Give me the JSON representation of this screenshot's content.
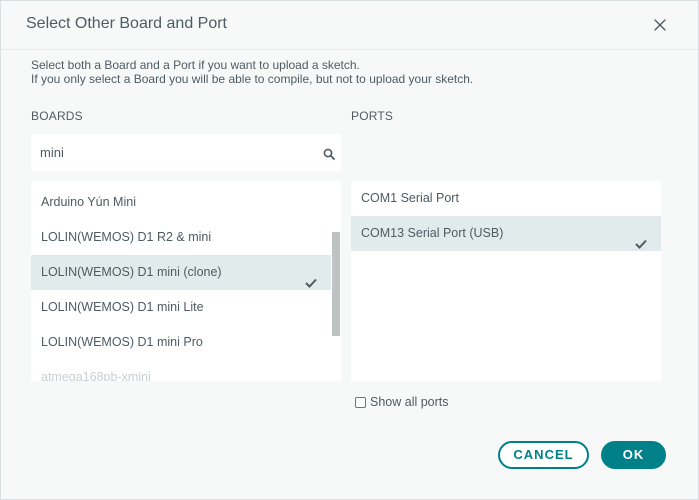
{
  "dialog": {
    "title": "Select Other Board and Port",
    "description_line1": "Select both a Board and a Port if you want to upload a sketch.",
    "description_line2": "If you only select a Board you will be able to compile, but not to upload your sketch."
  },
  "boards": {
    "label": "BOARDS",
    "search_value": "mini",
    "items": [
      {
        "label": "Arduino Yún Mini"
      },
      {
        "label": "LOLIN(WEMOS) D1 R2 & mini"
      },
      {
        "label": "LOLIN(WEMOS) D1 mini (clone)",
        "selected": true
      },
      {
        "label": "LOLIN(WEMOS) D1 mini Lite"
      },
      {
        "label": "LOLIN(WEMOS) D1 mini Pro"
      },
      {
        "label": "atmega168pb-xmini"
      }
    ]
  },
  "ports": {
    "label": "PORTS",
    "items": [
      {
        "label": "COM1 Serial Port"
      },
      {
        "label": "COM13 Serial Port (USB)",
        "selected": true
      }
    ],
    "show_all_label": "Show all ports",
    "show_all_checked": false
  },
  "buttons": {
    "cancel": "CANCEL",
    "ok": "OK"
  },
  "colors": {
    "accent": "#00818a",
    "selected_row": "#e2ebeb",
    "dialog_bg": "#f7f9f9",
    "text": "#4e5b61"
  },
  "icons": {
    "close": "close-icon",
    "search": "search-icon",
    "check": "check-icon"
  }
}
